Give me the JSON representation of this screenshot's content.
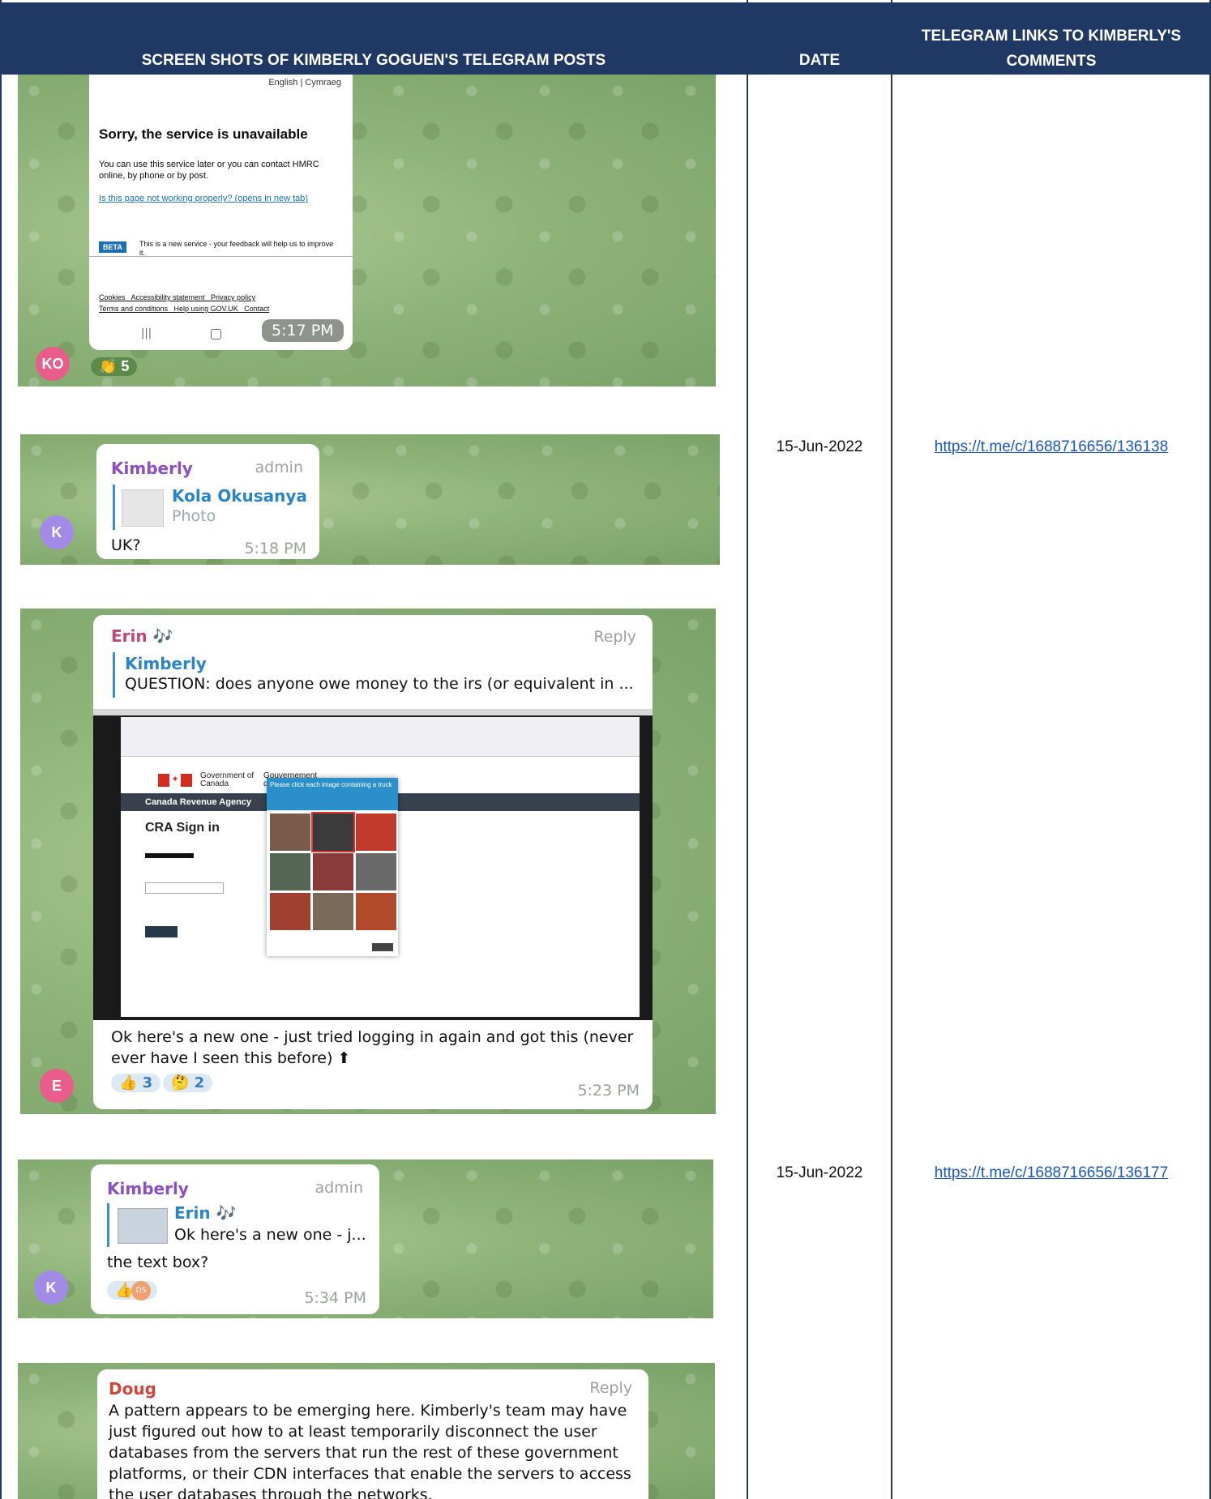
{
  "header": {
    "col1": "SCREEN SHOTS OF KIMBERLY GOGUEN'S TELEGRAM POSTS",
    "col2": "DATE",
    "col3": "TELEGRAM LINKS TO KIMBERLY'S COMMENTS"
  },
  "rows": [
    {
      "date": "15-Jun-2022",
      "link": "https://t.me/c/1688716656/136138"
    },
    {
      "date": "15-Jun-2022",
      "link": "https://t.me/c/1688716656/136177"
    }
  ],
  "shot1": {
    "lang": "English | Cymraeg",
    "title": "Sorry, the service is unavailable",
    "body1": "You can use this service later or you can contact HMRC online, by phone or by post.",
    "link1": "Is this page not working properly? (opens in new tab)",
    "beta": "BETA",
    "beta_text": "This is a new service - your feedback will help us to improve it.",
    "footer1": "Cookies   Accessibility statement   Privacy policy",
    "footer2": "Terms and conditions   Help using GOV.UK   Contact",
    "time": "5:17 PM",
    "avatar": "KO",
    "reaction": "👏 5"
  },
  "shot2": {
    "sender": "Kimberly",
    "role": "admin",
    "quote_name": "Kola Okusanya",
    "quote_type": "Photo",
    "text": "UK?",
    "time": "5:18 PM",
    "avatar": "K"
  },
  "shot3": {
    "sender": "Erin 🎶",
    "reply": "Reply",
    "quote_name": "Kimberly",
    "quote_text": "QUESTION: does anyone owe money to the irs (or equivalent in ...",
    "gov1": "Government of Canada",
    "gov2": "Gouvernement du Canada",
    "agency": "Canada Revenue Agency",
    "signin": "CRA Sign in",
    "captcha": "Please click each image containing a truck",
    "text": "Ok here's a new one - just tried logging in again and got this (never ever have I seen this before) ⬆",
    "react1": "👍 3",
    "react2": "🤔 2",
    "time": "5:23 PM",
    "avatar": "E"
  },
  "shot4": {
    "sender": "Kimberly",
    "role": "admin",
    "quote_name": "Erin 🎶",
    "quote_text": "Ok here's a new one - j...",
    "text": "the text box?",
    "react": "👍",
    "time": "5:34 PM",
    "avatar": "K"
  },
  "shot5": {
    "sender": "Doug",
    "reply": "Reply",
    "text": "A pattern appears to be emerging here. Kimberly's team may have just figured out how to at least temporarily disconnect the user databases from the servers that run the rest of these government platforms, or their CDN interfaces that enable the servers to access the user databases through the networks."
  }
}
